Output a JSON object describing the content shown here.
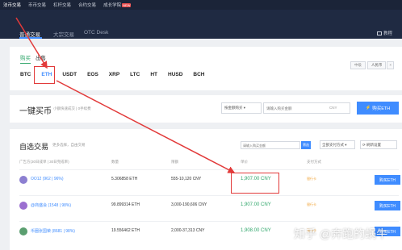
{
  "topbar": {
    "items": [
      {
        "label": "法币交易",
        "active": true
      },
      {
        "label": "币币交易",
        "active": false
      },
      {
        "label": "杠杆交易",
        "active": false
      },
      {
        "label": "合约交易",
        "active": false
      },
      {
        "label": "成长学院",
        "active": false,
        "badge": "NEW"
      }
    ]
  },
  "subnav": {
    "tabs": [
      {
        "label": "普通交易",
        "active": true
      },
      {
        "label": "大宗交易",
        "active": false
      },
      {
        "label": "OTC Desk",
        "active": false
      }
    ],
    "tutorial_label": "教程"
  },
  "pairs": {
    "buy_label": "购买",
    "sell_label": "出售",
    "coins": [
      "BTC",
      "ETH",
      "USDT",
      "EOS",
      "XRP",
      "LTC",
      "HT",
      "HUSD",
      "BCH"
    ],
    "active_coin": "ETH",
    "mini_buttons": [
      "中级",
      "人民币"
    ]
  },
  "quick": {
    "title": "一键买币",
    "subtitle": "小额快速成交 | 0手续费",
    "method_select": "按金额购买",
    "amount_placeholder": "请输入购买金额",
    "amount_unit": "CNY",
    "buy_button": "购买ETH"
  },
  "selfselect": {
    "title": "自选交易",
    "subtitle": "更多选择，自由交易",
    "filter_placeholder": "请输入购买金额",
    "filter_button": "筛选",
    "pay_all": "全部支付方式",
    "refresh": "刷新设置",
    "columns": [
      "广告方(30日成单 | 30日完成率)",
      "数量",
      "限额",
      "单价",
      "支付方式"
    ]
  },
  "rows": [
    {
      "user": "OO12 (962 | 96%)",
      "qty": "5.306858 ETH",
      "limit": "555-10,120 CNY",
      "price": "1,907.00 CNY",
      "pay": "银行卡",
      "buy": "购买ETH"
    },
    {
      "user": "@商盛会 (1548 | 98%)",
      "qty": "99.899314 ETH",
      "limit": "3,000-190,606 CNY",
      "price": "1,907.00 CNY",
      "pay": "银行卡",
      "buy": "购买ETH"
    },
    {
      "user": "币圈张国荣 (8681 | 98%)",
      "qty": "19.556462 ETH",
      "limit": "2,000-37,313 CNY",
      "price": "1,908.00 CNY",
      "pay": "银行卡",
      "buy": "购买ETH"
    }
  ],
  "watermark": "知乎 @奔跑的蜗牛",
  "colors": {
    "accent": "#3f8cff",
    "price_green": "#2fa66a",
    "annotation_red": "#e23a3a",
    "header_dark": "#1b2438"
  }
}
